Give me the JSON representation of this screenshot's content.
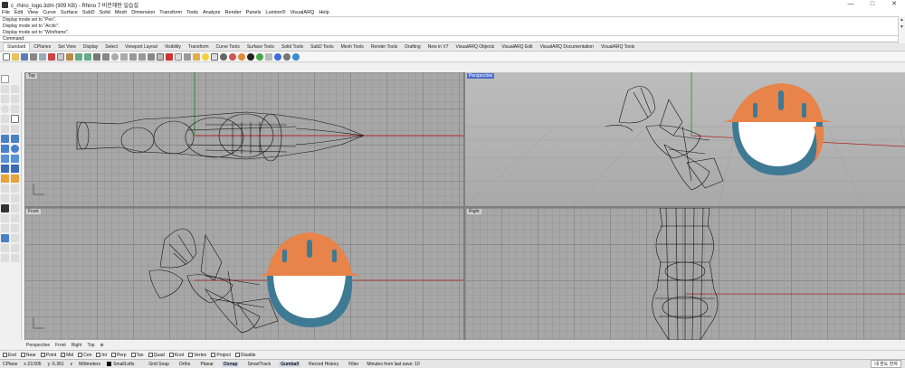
{
  "window": {
    "title": "c_rhino_logo.3dm (909 KB) - Rhino 7 비전해판 일습설",
    "controls": [
      "—",
      "□",
      "✕"
    ]
  },
  "menu": [
    "File",
    "Edit",
    "View",
    "Curve",
    "Surface",
    "SubD",
    "Solid",
    "Mesh",
    "Dimension",
    "Transform",
    "Tools",
    "Analyze",
    "Render",
    "Panels",
    "Lumion®",
    "VisualARQ",
    "Help"
  ],
  "command_history": [
    "Display mode set to \"Pen\".",
    "Display mode set to \"Arctic\".",
    "Display mode set to \"Wireframe\"."
  ],
  "command_prompt": "Command:",
  "toolbar_tabs": [
    "Standard",
    "CPlanes",
    "Set View",
    "Display",
    "Select",
    "Viewport Layout",
    "Visibility",
    "Transform",
    "Curve Tools",
    "Surface Tools",
    "Solid Tools",
    "SubD Tools",
    "Mesh Tools",
    "Render Tools",
    "Drafting",
    "New in V7",
    "VisualARQ Objects",
    "VisualARQ Edit",
    "VisualARQ Documentation",
    "VisualARQ Tools"
  ],
  "active_tab": "Standard",
  "viewports": {
    "top": "Top",
    "perspective": "Perspective",
    "front": "Front",
    "right": "Right"
  },
  "viewport_tabs": [
    "Perspective",
    "Front",
    "Right",
    "Top",
    "⊕"
  ],
  "osnaps": [
    {
      "label": "End",
      "checked": false
    },
    {
      "label": "Near",
      "checked": false
    },
    {
      "label": "Point",
      "checked": false
    },
    {
      "label": "Mid",
      "checked": true
    },
    {
      "label": "Cen",
      "checked": false
    },
    {
      "label": "Int",
      "checked": false
    },
    {
      "label": "Perp",
      "checked": false
    },
    {
      "label": "Tan",
      "checked": false
    },
    {
      "label": "Quad",
      "checked": false
    },
    {
      "label": "Knot",
      "checked": false
    },
    {
      "label": "Vertex",
      "checked": false
    },
    {
      "label": "Project",
      "checked": false
    },
    {
      "label": "Disable",
      "checked": false
    }
  ],
  "status": {
    "cplane": "CPlane",
    "x": "x 23.505",
    "y": "y -5.361",
    "z": "z",
    "units": "Millimeters",
    "layer": "SmallLofts",
    "panes": [
      "Grid Snap",
      "Ortho",
      "Planar",
      "Osnap",
      "SmartTrack",
      "Gumball",
      "Record History",
      "Filter"
    ],
    "active_panes": [
      "Osnap",
      "Gumball"
    ],
    "save_info": "Minutes from last save: 10",
    "ime": "네 한도 한자"
  },
  "colors": {
    "helmet_orange": "#e8834a",
    "helmet_blue": "#3f7a94",
    "axis_red": "#b02424",
    "axis_green": "#2c8a2c",
    "viewport_bg": "#a7a7a7",
    "active_label": "#4a6fd0"
  }
}
